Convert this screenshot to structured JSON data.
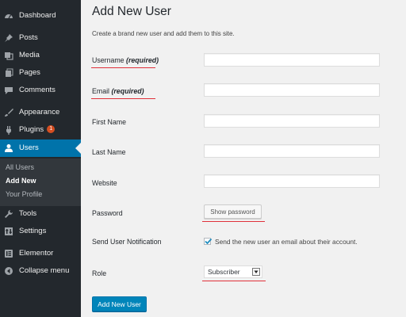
{
  "sidebar": {
    "items": [
      {
        "label": "Dashboard",
        "icon": "dashboard-icon"
      },
      {
        "label": "Posts",
        "icon": "pin-icon"
      },
      {
        "label": "Media",
        "icon": "media-icon"
      },
      {
        "label": "Pages",
        "icon": "page-icon"
      },
      {
        "label": "Comments",
        "icon": "comment-icon"
      },
      {
        "label": "Appearance",
        "icon": "brush-icon"
      },
      {
        "label": "Plugins",
        "icon": "plug-icon",
        "badge": "1"
      },
      {
        "label": "Users",
        "icon": "user-icon",
        "active": true
      },
      {
        "label": "Tools",
        "icon": "wrench-icon"
      },
      {
        "label": "Settings",
        "icon": "settings-icon"
      },
      {
        "label": "Elementor",
        "icon": "elementor-icon"
      },
      {
        "label": "Collapse menu",
        "icon": "collapse-icon"
      }
    ],
    "submenu": [
      {
        "label": "All Users"
      },
      {
        "label": "Add New",
        "current": true
      },
      {
        "label": "Your Profile"
      }
    ]
  },
  "page": {
    "title": "Add New User",
    "subtitle": "Create a brand new user and add them to this site."
  },
  "form": {
    "username_label": "Username",
    "username_required": "(required)",
    "email_label": "Email",
    "email_required": "(required)",
    "first_name_label": "First Name",
    "last_name_label": "Last Name",
    "website_label": "Website",
    "password_label": "Password",
    "show_password_label": "Show password",
    "notification_label": "Send User Notification",
    "notification_text": "Send the new user an email about their account.",
    "notification_checked": true,
    "role_label": "Role",
    "role_value": "Subscriber",
    "submit_label": "Add New User"
  },
  "colors": {
    "sidebar_bg": "#23282d",
    "active_blue": "#0073aa",
    "primary_button": "#0085ba",
    "annotation_underline": "#e0303a",
    "badge": "#d54e21"
  }
}
